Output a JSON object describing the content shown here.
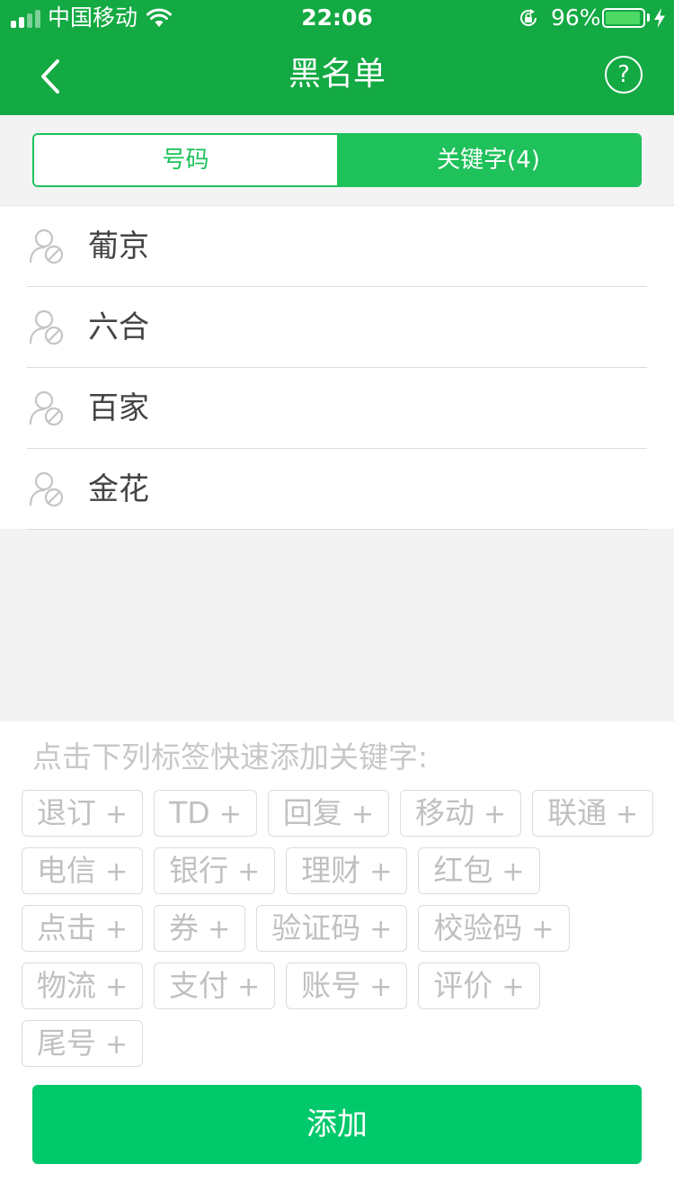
{
  "status_bar": {
    "carrier": "中国移动",
    "time": "22:06",
    "battery_percent": "96%",
    "battery_level": 0.96
  },
  "nav": {
    "title": "黑名单",
    "back_icon": "chevron-left-icon",
    "help_label": "?"
  },
  "tabs": [
    {
      "label": "号码",
      "active": false
    },
    {
      "label": "关键字(4)",
      "active": true
    }
  ],
  "keywords": [
    {
      "label": "葡京"
    },
    {
      "label": "六合"
    },
    {
      "label": "百家"
    },
    {
      "label": "金花"
    }
  ],
  "quick_add": {
    "hint": "点击下列标签快速添加关键字:",
    "plus": "+",
    "rows": [
      [
        "退订",
        "TD",
        "回复",
        "移动",
        "联通"
      ],
      [
        "电信",
        "银行",
        "理财",
        "红包"
      ],
      [
        "点击",
        "券",
        "验证码",
        "校验码"
      ],
      [
        "物流",
        "支付",
        "账号",
        "评价"
      ],
      [
        "尾号"
      ]
    ]
  },
  "add_button": {
    "label": "添加"
  },
  "colors": {
    "brand_green": "#13a943",
    "tab_green": "#1ec15a",
    "button_green": "#00c96b"
  }
}
